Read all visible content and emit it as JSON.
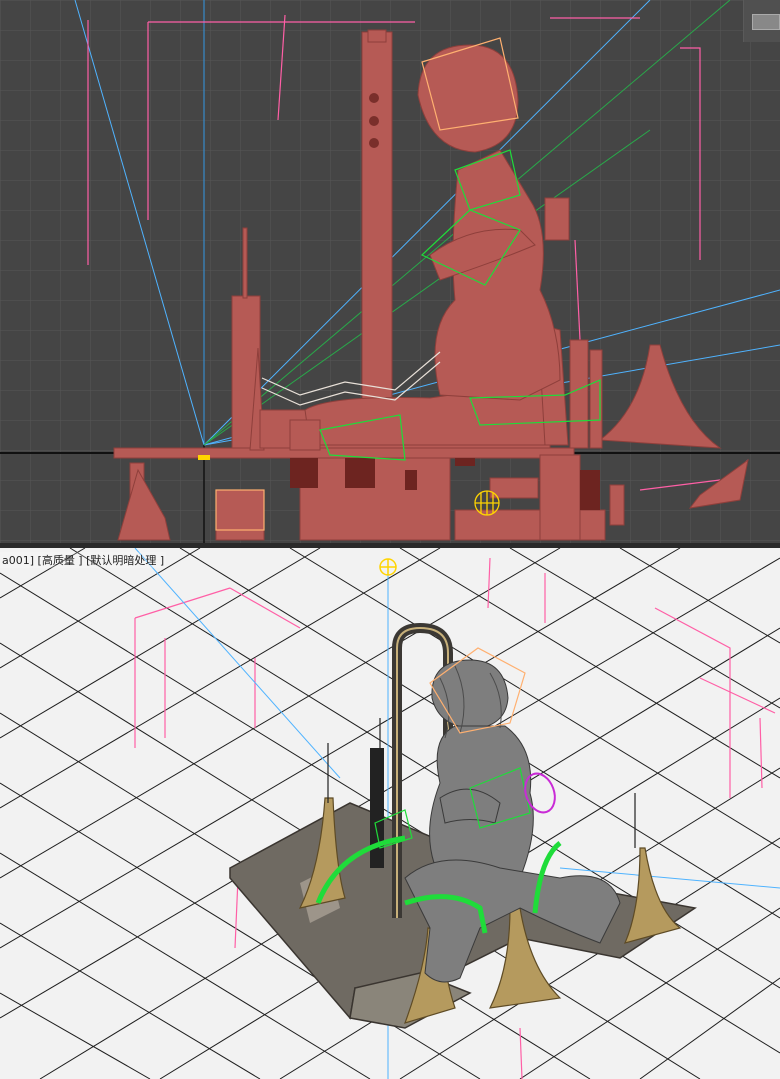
{
  "app": {
    "layout": "two-viewport 3D editor"
  },
  "viewport_top": {
    "label": "",
    "background": "#454545",
    "grid_color": "#565656",
    "model_color": "#b65a55",
    "navigation_cube": "view-cube-icon"
  },
  "viewport_bottom": {
    "label": "a001] [高质量 ] [默认明暗处理 ]",
    "background": "#f2f2f2",
    "grid_color": "#1e1e1e",
    "model_color": "#7a7a7a",
    "gizmo_color": "#ffd400"
  },
  "colors": {
    "camera_line": "#4fb3ff",
    "helper_pink": "#ff5fa6",
    "bone_green": "#1fdc3a",
    "bound_orange": "#ffb070"
  }
}
